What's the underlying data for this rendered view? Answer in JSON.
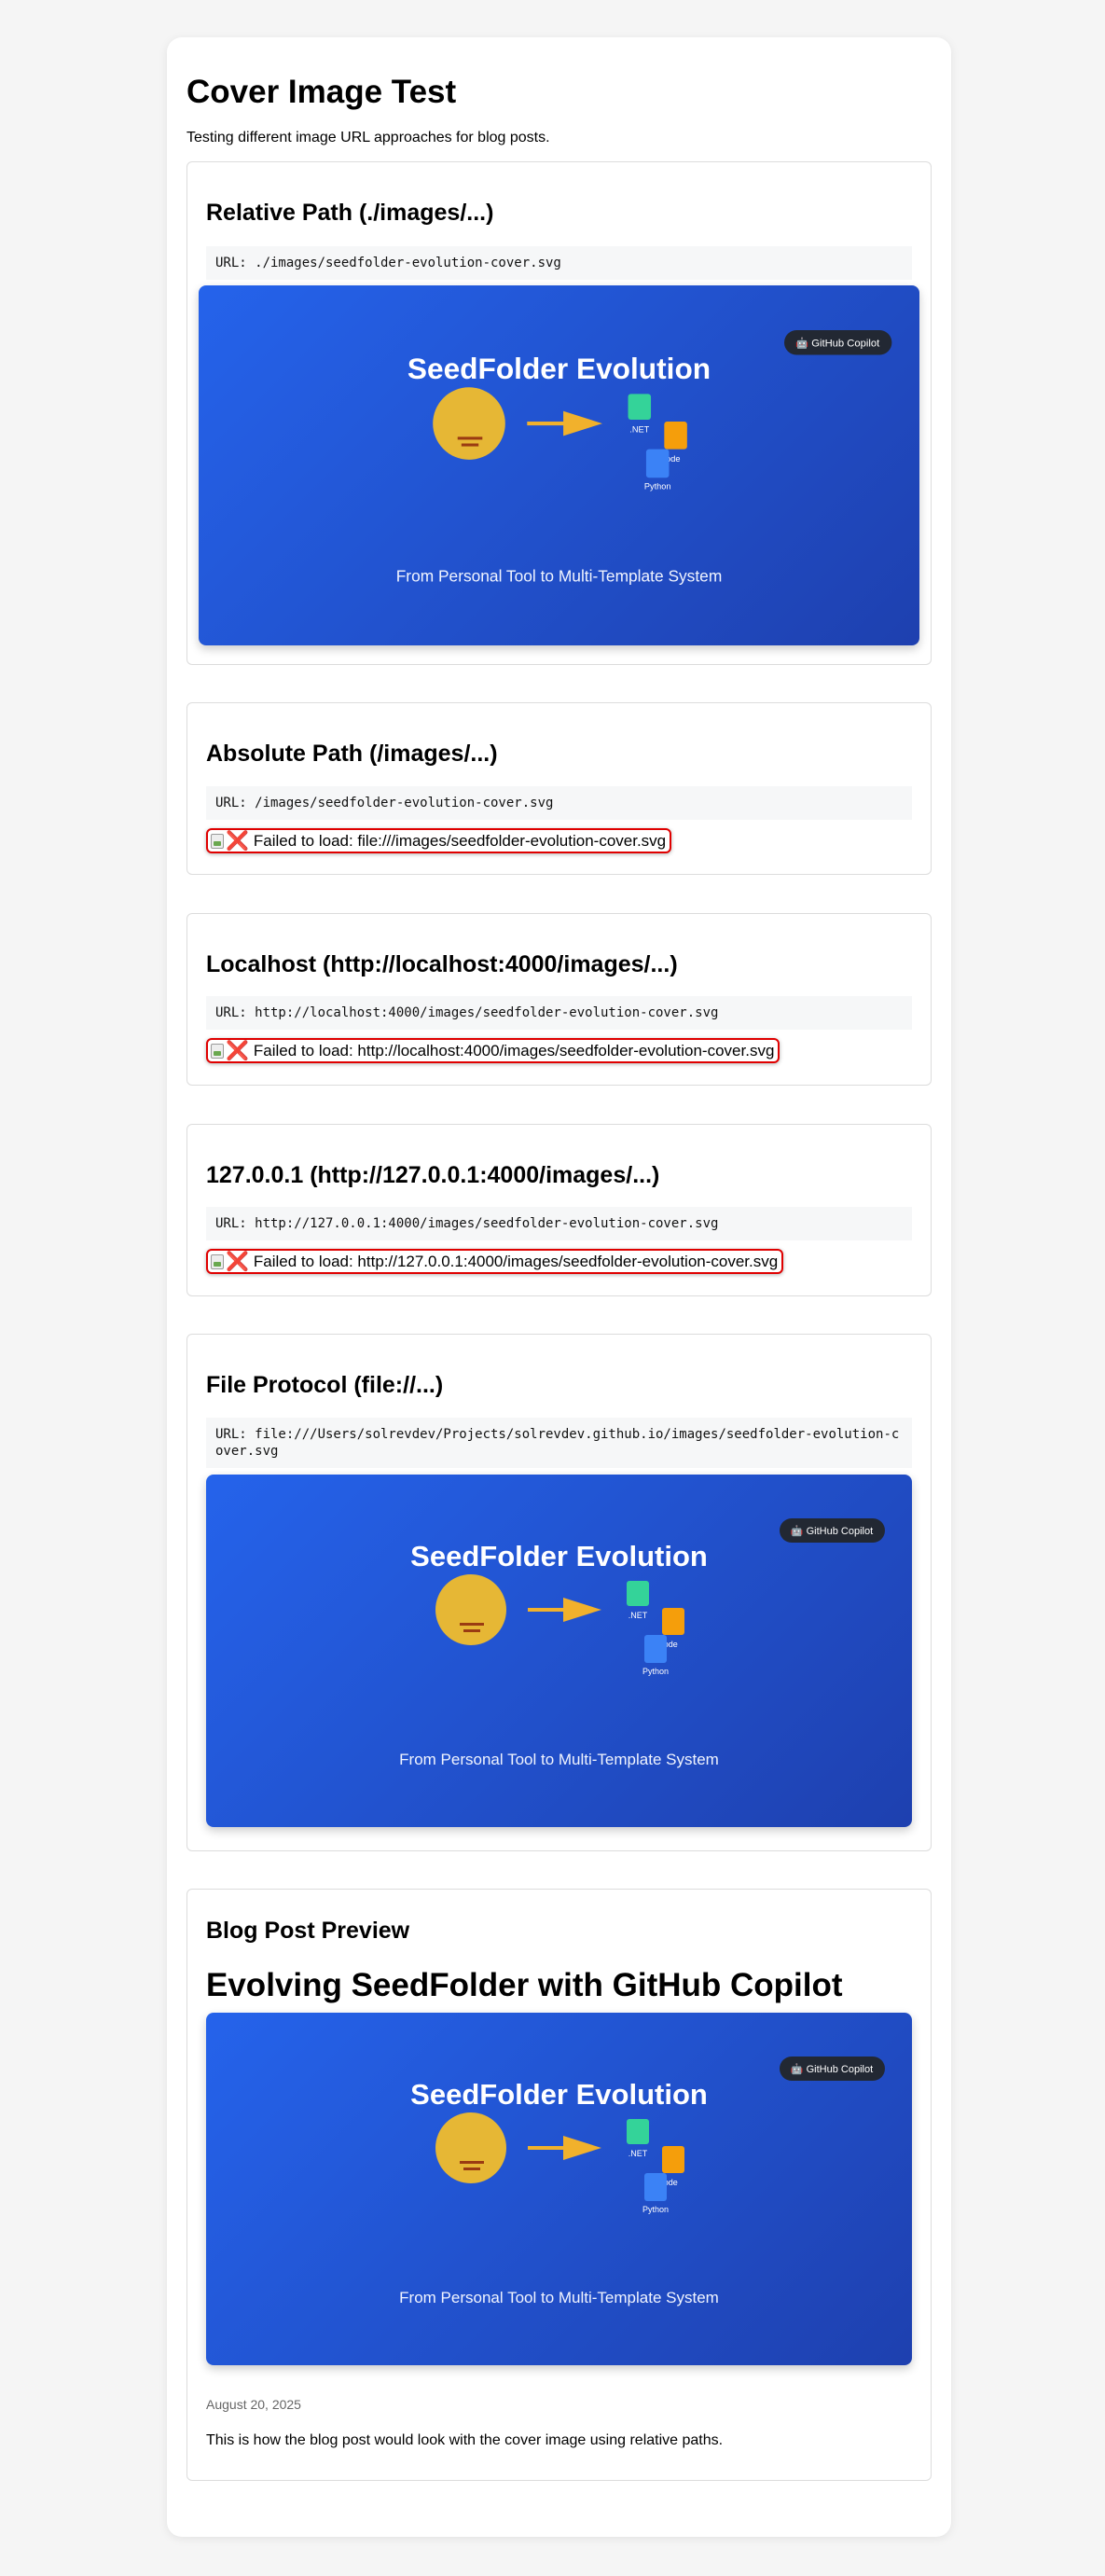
{
  "page": {
    "title": "Cover Image Test",
    "intro": "Testing different image URL approaches for blog posts."
  },
  "cover_art": {
    "heading": "SeedFolder Evolution",
    "badge": "🤖 GitHub Copilot",
    "tagline": "From Personal Tool to Multi-Template System",
    "labels": {
      "dotnet": ".NET",
      "node": "Node",
      "python": "Python"
    },
    "colors": {
      "bg_start": "#2563eb",
      "bg_end": "#1e40af",
      "sun": "#e6b735",
      "arrow": "#f1b12c",
      "dotnet": "#34d399",
      "node": "#f59e0b",
      "python": "#3b82f6"
    }
  },
  "sections": [
    {
      "heading": "Relative Path (./images/...)",
      "url_text": "URL: ./images/seedfolder-evolution-cover.svg",
      "status": "loaded"
    },
    {
      "heading": "Absolute Path (/images/...)",
      "url_text": "URL: /images/seedfolder-evolution-cover.svg",
      "status": "failed",
      "error_text": "Failed to load: file:///images/seedfolder-evolution-cover.svg",
      "error_icon": "❌"
    },
    {
      "heading": "Localhost (http://localhost:4000/images/...)",
      "url_text": "URL: http://localhost:4000/images/seedfolder-evolution-cover.svg",
      "status": "failed",
      "error_text": "Failed to load: http://localhost:4000/images/seedfolder-evolution-cover.svg",
      "error_icon": "❌"
    },
    {
      "heading": "127.0.0.1 (http://127.0.0.1:4000/images/...)",
      "url_text": "URL: http://127.0.0.1:4000/images/seedfolder-evolution-cover.svg",
      "status": "failed",
      "error_text": "Failed to load: http://127.0.0.1:4000/images/seedfolder-evolution-cover.svg",
      "error_icon": "❌"
    },
    {
      "heading": "File Protocol (file://...)",
      "url_text": "URL: file:///Users/solrevdev/Projects/solrevdev.github.io/images/seedfolder-evolution-cover.svg",
      "status": "loaded"
    }
  ],
  "preview": {
    "label": "Blog Post Preview",
    "post_title": "Evolving SeedFolder with GitHub Copilot",
    "date": "August 20, 2025",
    "body": "This is how the blog post would look with the cover image using relative paths."
  }
}
